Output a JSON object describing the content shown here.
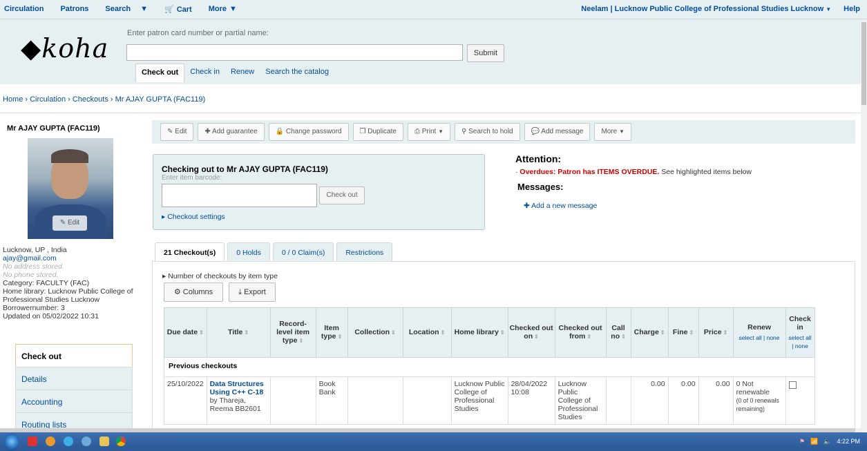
{
  "topnav": {
    "circulation": "Circulation",
    "patrons": "Patrons",
    "search": "Search",
    "cart": "Cart",
    "more": "More",
    "user": "Neelam",
    "branch": "Lucknow Public College of Professional Studies Lucknow",
    "help": "Help"
  },
  "header": {
    "logo": "koha",
    "search_label": "Enter patron card number or partial name:",
    "search_value": "",
    "submit": "Submit",
    "tabs": [
      "Check out",
      "Check in",
      "Renew",
      "Search the catalog"
    ]
  },
  "breadcrumb": "Home › Circulation › Checkouts › Mr AJAY GUPTA (FAC119)",
  "patron": {
    "name": "Mr AJAY GUPTA (FAC119)",
    "edit": "Edit",
    "city": "Lucknow, UP , India",
    "email": "ajay@gmail.com",
    "no_address": "No address stored.",
    "no_phone": "No phone stored.",
    "category": "Category: FACULTY (FAC)",
    "home_library": "Home library: Lucknow Public College of Professional Studies Lucknow",
    "borrowernumber": "Borrowernumber: 3",
    "updated": "Updated on 05/02/2022 10:31"
  },
  "sidemenu": [
    "Check out",
    "Details",
    "Accounting",
    "Routing lists"
  ],
  "toolbar": [
    "Edit",
    "Add guarantee",
    "Change password",
    "Duplicate",
    "Print",
    "Search to hold",
    "Add message",
    "More"
  ],
  "checkout": {
    "heading": "Checking out to Mr AJAY GUPTA (FAC119)",
    "barcode_label": "Enter item barcode:",
    "barcode_value": "",
    "button": "Check out",
    "settings": "Checkout settings"
  },
  "attention": {
    "title": "Attention:",
    "overdues_label": "Overdues: Patron has ITEMS OVERDUE.",
    "overdues_note": "See highlighted items below",
    "messages": "Messages:",
    "add_message": "Add a new message"
  },
  "checkout_tabs": [
    "21 Checkout(s)",
    "0 Holds",
    "0 / 0 Claim(s)",
    "Restrictions"
  ],
  "panel": {
    "number_by_type": "Number of checkouts by item type",
    "columns": "Columns",
    "export": "Export"
  },
  "table": {
    "headers": [
      "Due date",
      "Title",
      "Record-level item type",
      "Item type",
      "Collection",
      "Location",
      "Home library",
      "Checked out on",
      "Checked out from",
      "Call no",
      "Charge",
      "Fine",
      "Price",
      "Renew",
      "Check in"
    ],
    "renew_sub": "select all | none",
    "checkin_sub": "select all | none",
    "group": "Previous checkouts",
    "rows": [
      {
        "due": "25/10/2022",
        "title": "Data Structures Using C++ C-18",
        "author": "by Thareja, Reema BB2601",
        "rl_type": "",
        "item_type": "Book Bank",
        "collection": "",
        "location": "",
        "home_library": "Lucknow Public College of Professional Studies",
        "checked_out_on": "28/04/2022 10:08",
        "checked_out_from": "Lucknow Public College of Professional Studies",
        "call_no": "",
        "charge": "0.00",
        "fine": "0.00",
        "price": "0.00",
        "renew": "0  Not renewable",
        "renew_note": "(0 of 0 renewals remaining)"
      }
    ]
  },
  "taskbar": {
    "clock": "4:22 PM"
  }
}
